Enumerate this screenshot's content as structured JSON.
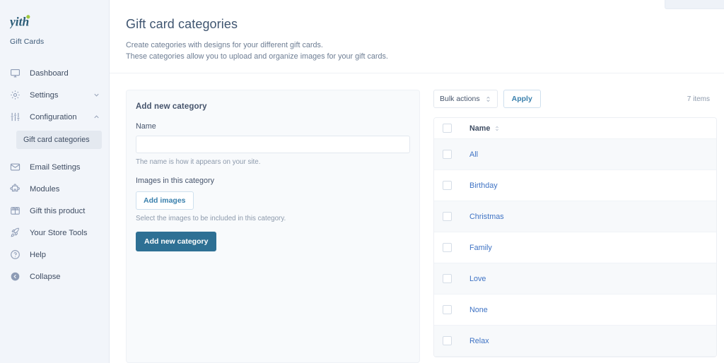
{
  "sidebar": {
    "logo_text": "yith",
    "logo_subtitle": "Gift Cards",
    "items": [
      {
        "label": "Dashboard",
        "icon": "monitor-icon",
        "chevron": ""
      },
      {
        "label": "Settings",
        "icon": "gear-icon",
        "chevron": "down"
      },
      {
        "label": "Configuration",
        "icon": "sliders-icon",
        "chevron": "up"
      },
      {
        "label": "Email Settings",
        "icon": "envelope-icon",
        "chevron": ""
      },
      {
        "label": "Modules",
        "icon": "puzzle-icon",
        "chevron": ""
      },
      {
        "label": "Gift this product",
        "icon": "gift-grid-icon",
        "chevron": ""
      },
      {
        "label": "Your Store Tools",
        "icon": "rocket-icon",
        "chevron": ""
      },
      {
        "label": "Help",
        "icon": "question-circle-icon",
        "chevron": ""
      },
      {
        "label": "Collapse",
        "icon": "collapse-arrow-icon",
        "chevron": ""
      }
    ],
    "subitem_active": "Gift card categories"
  },
  "header": {
    "title": "Gift card categories",
    "description_line1": "Create categories with designs for your different gift cards.",
    "description_line2": "These categories allow you to upload and organize images for your gift cards."
  },
  "add_category": {
    "heading": "Add new category",
    "name_label": "Name",
    "name_value": "",
    "name_placeholder": "",
    "name_help": "The name is how it appears on your site.",
    "images_label": "Images in this category",
    "add_images_button": "Add images",
    "images_help": "Select the images to be included in this category.",
    "submit_button": "Add new category"
  },
  "list": {
    "bulk_actions_label": "Bulk actions",
    "apply_button": "Apply",
    "items_count": "7 items",
    "column_name": "Name",
    "rows": [
      {
        "name": "All"
      },
      {
        "name": "Birthday"
      },
      {
        "name": "Christmas"
      },
      {
        "name": "Family"
      },
      {
        "name": "Love"
      },
      {
        "name": "None"
      },
      {
        "name": "Relax"
      }
    ]
  },
  "colors": {
    "brand_dark": "#2c5d78",
    "brand_green": "#9ec73f",
    "primary_button": "#2e7094",
    "link_blue": "#3f73c4",
    "sidebar_bg": "#f2f5fa"
  }
}
